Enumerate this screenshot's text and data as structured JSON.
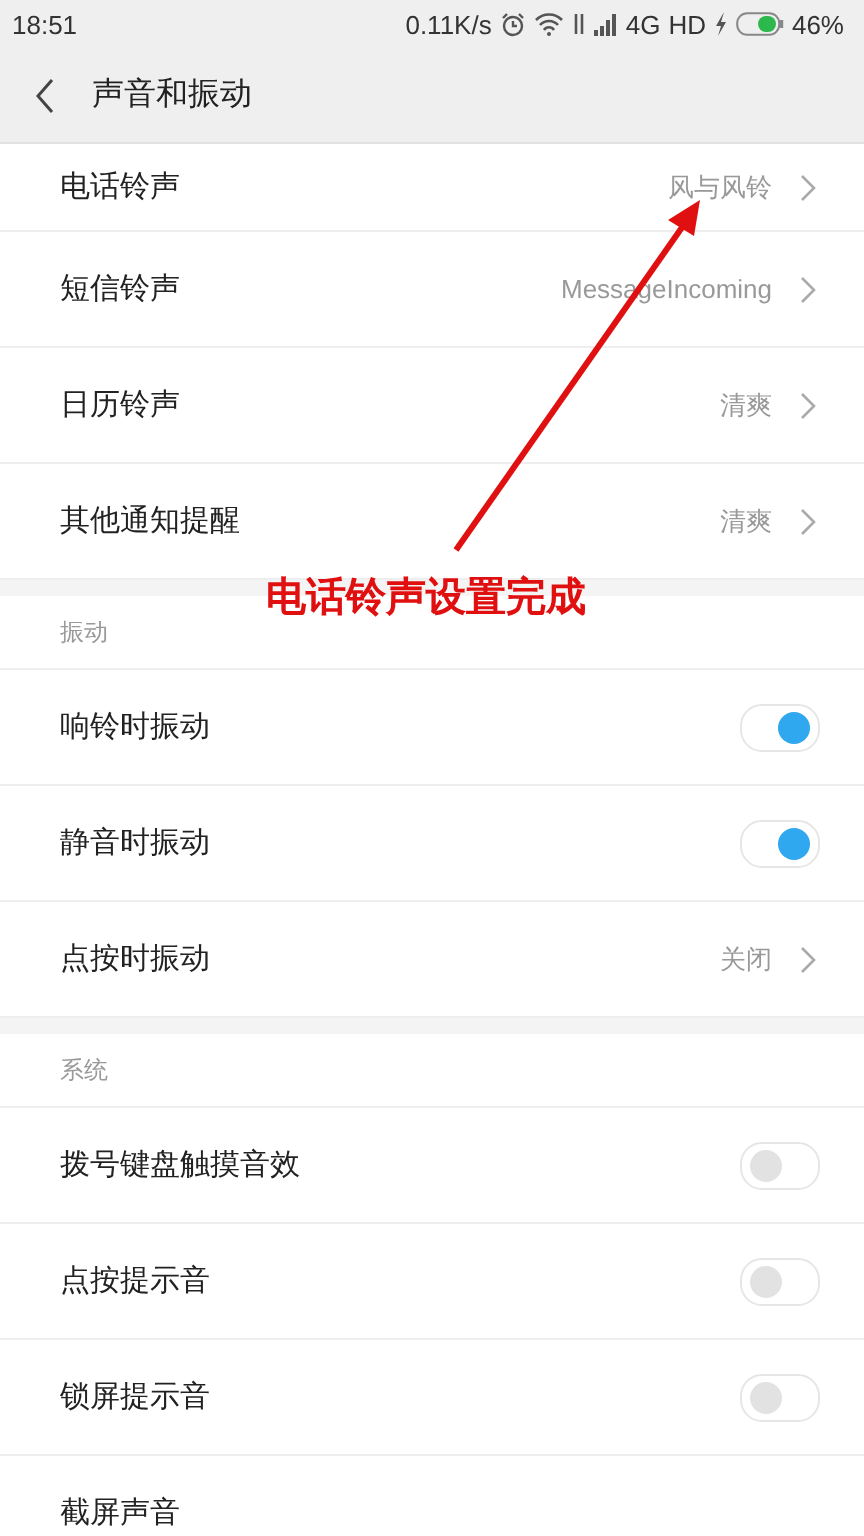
{
  "status_bar": {
    "time": "18:51",
    "speed": "0.11K/s",
    "network": "4G",
    "hd": "HD",
    "battery": "46%"
  },
  "header": {
    "title": "声音和振动"
  },
  "sections": [
    {
      "items": [
        {
          "kind": "link",
          "label": "电话铃声",
          "value": "风与风铃"
        },
        {
          "kind": "link",
          "label": "短信铃声",
          "value": "MessageIncoming"
        },
        {
          "kind": "link",
          "label": "日历铃声",
          "value": "清爽"
        },
        {
          "kind": "link",
          "label": "其他通知提醒",
          "value": "清爽"
        }
      ]
    },
    {
      "title": "振动",
      "items": [
        {
          "kind": "toggle",
          "label": "响铃时振动",
          "on": true
        },
        {
          "kind": "toggle",
          "label": "静音时振动",
          "on": true
        },
        {
          "kind": "link",
          "label": "点按时振动",
          "value": "关闭"
        }
      ]
    },
    {
      "title": "系统",
      "items": [
        {
          "kind": "toggle",
          "label": "拨号键盘触摸音效",
          "on": false
        },
        {
          "kind": "toggle",
          "label": "点按提示音",
          "on": false
        },
        {
          "kind": "toggle",
          "label": "锁屏提示音",
          "on": false
        },
        {
          "kind": "plain",
          "label": "截屏声音"
        }
      ]
    }
  ],
  "annotation": {
    "text": "电话铃声设置完成"
  }
}
